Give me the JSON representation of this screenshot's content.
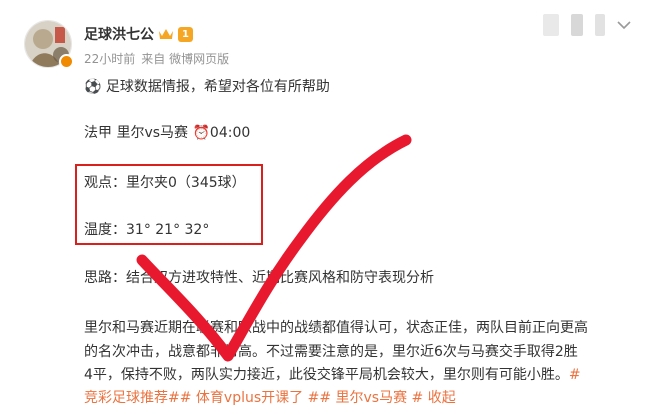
{
  "colors": {
    "accent": "#eb7340",
    "highlight_box": "#d9201d",
    "check_mark": "#e8192f",
    "meta_gray": "#939393"
  },
  "author": {
    "name": "足球洪七公",
    "level": "1",
    "avatar_icon": "avatar-icon",
    "time": "22小时前",
    "source": "来自 微博网页版"
  },
  "post": {
    "line1": "⚽ 足球数据情报，希望对各位有所帮助",
    "match": "法甲 里尔vs马赛 ⏰04:00",
    "viewpoint": "观点：里尔夹0（345球）",
    "temperature": "温度：31° 21° 32°",
    "analysis": "思路：结合双方进攻特性、近期比赛风格和防守表现分析",
    "body_1": "里尔和马赛近期在联赛和欧战中的战绩都值得认可，状态正佳，两队目前正向更高",
    "body_2": "的名次冲击，战意都非常高。不过需要注意的是，里尔近6次与马赛交手取得2胜",
    "body_3": "4平，保持不败，两队实力接近，此役交锋平局机会较大，里尔则有可能小胜。",
    "topic_tail": "#",
    "topics_line": "竞彩足球推荐## 体育vplus开课了 ## 里尔vs马赛 # 收起"
  }
}
